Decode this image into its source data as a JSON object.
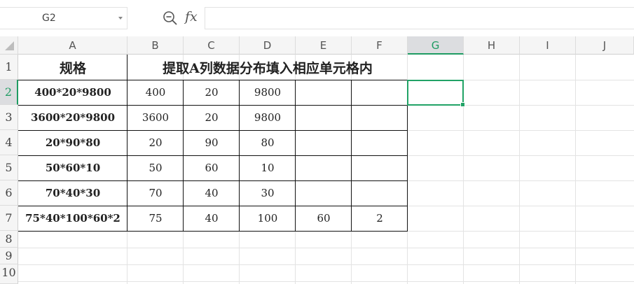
{
  "formula_bar": {
    "name_box": "G2",
    "fx_label": "fx",
    "formula_value": ""
  },
  "columns": [
    "A",
    "B",
    "C",
    "D",
    "E",
    "F",
    "G",
    "H",
    "I",
    "J"
  ],
  "rows": [
    "1",
    "2",
    "3",
    "4",
    "5",
    "6",
    "7",
    "8",
    "9",
    "10"
  ],
  "selected_cell": "G2",
  "cells": {
    "A1": "规格",
    "B1": "提取A列数据分布填入相应单元格内",
    "A2": "400*20*9800",
    "B2": "400",
    "C2": "20",
    "D2": "9800",
    "E2": "",
    "F2": "",
    "A3": "3600*20*9800",
    "B3": "3600",
    "C3": "20",
    "D3": "9800",
    "E3": "",
    "F3": "",
    "A4": "20*90*80",
    "B4": "20",
    "C4": "90",
    "D4": "80",
    "E4": "",
    "F4": "",
    "A5": "50*60*10",
    "B5": "50",
    "C5": "60",
    "D5": "10",
    "E5": "",
    "F5": "",
    "A6": "70*40*30",
    "B6": "70",
    "C6": "40",
    "D6": "30",
    "E6": "",
    "F6": "",
    "A7": "75*40*100*60*2",
    "B7": "75",
    "C7": "40",
    "D7": "100",
    "E7": "60",
    "F7": "2",
    "G2": ""
  },
  "colors": {
    "accent": "#21a366",
    "header_bg": "#f5f5f5",
    "grid": "#e3e3e3"
  },
  "icons": {
    "zoom": "zoom-formula-icon",
    "dropdown": "chevron-down-icon"
  }
}
